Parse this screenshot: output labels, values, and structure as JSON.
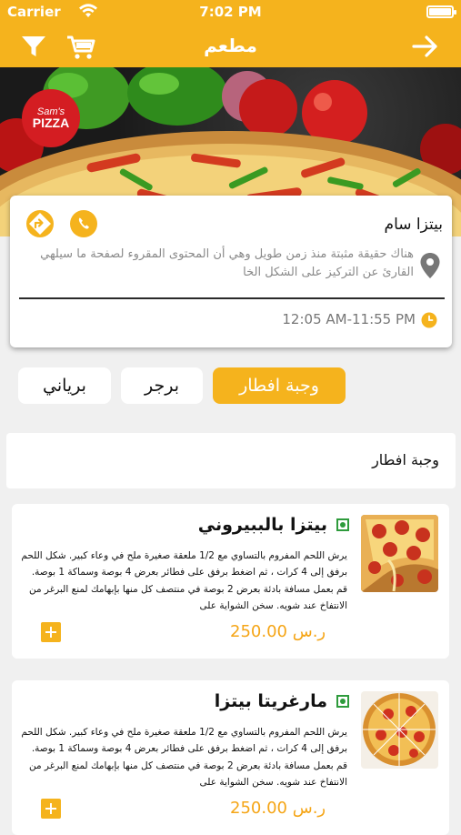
{
  "status_bar": {
    "carrier": "Carrier",
    "time": "7:02 PM"
  },
  "nav": {
    "title": "مطعم",
    "icons": [
      "filter-icon",
      "cart-icon",
      "forward-arrow-icon"
    ]
  },
  "hero": {
    "logo_line1": "Sam's",
    "logo_line2": "PIZZA"
  },
  "restaurant": {
    "name": "بيتزا سام",
    "description": "هناك حقيقة مثبتة منذ زمن طويل وهي أن المحتوى المقروء لصفحة ما سيلهي القارئ عن التركيز على الشكل الخا",
    "hours": "12:05 AM-11:55 PM"
  },
  "tabs": [
    {
      "label": "وجبة افطار",
      "active": true
    },
    {
      "label": "برجر",
      "active": false
    },
    {
      "label": "برياني",
      "active": false
    }
  ],
  "section": {
    "title": "وجبة افطار"
  },
  "items": [
    {
      "name": "بيتزا بالببيروني",
      "desc": "يرش اللحم المفروم بالتساوي مع 1/2 ملعقة صغيرة ملح في وعاء كبير. شكل اللحم برفق إلى 4 كرات ، ثم اضغط برفق على فطائر بعرض 4 بوصة وسماكة 1 بوصة. قم بعمل مسافة بادئة بعرض 2 بوصة في منتصف كل منها بإبهامك لمنع البرغر من الانتفاخ عند شويه. سخن الشواية على",
      "price": "250.00 ر.س"
    },
    {
      "name": "مارغريتا بيتزا",
      "desc": "يرش اللحم المفروم بالتساوي مع 1/2 ملعقة صغيرة ملح في وعاء كبير. شكل اللحم برفق إلى 4 كرات ، ثم اضغط برفق على فطائر بعرض 4 بوصة وسماكة 1 بوصة. قم بعمل مسافة بادئة بعرض 2 بوصة في منتصف كل منها بإبهامك لمنع البرغر من الانتفاخ عند شويه. سخن الشواية على",
      "price": "250.00 ر.س"
    }
  ],
  "colors": {
    "accent": "#f5b31d",
    "price": "#f5a516",
    "veg": "#2e9b3c"
  }
}
